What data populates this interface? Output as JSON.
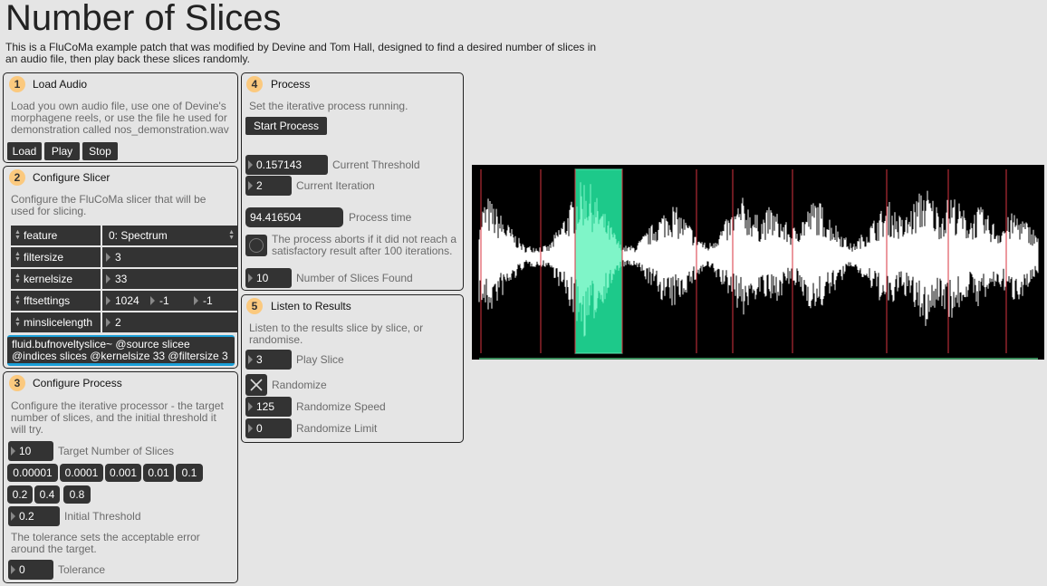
{
  "page": {
    "title": "Number of Slices",
    "description": "This is a FluCoMa example patch that was modified by Devine and Tom Hall, designed to find a desired number of slices in an audio file, then play back these slices randomly."
  },
  "colors": {
    "background": "#e5e5e5",
    "badge": "#fbc97e",
    "control": "#333333",
    "waveform_bg": "#000000",
    "waveform": "#ffffff",
    "selection": "#1dc98a",
    "slice_marker": "#d9333f"
  },
  "panel1": {
    "num": "1",
    "title": "Load Audio",
    "text": "Load you own audio file, use one of Devine's morphagene reels, or use the file he used for demonstration called nos_demonstration.wav",
    "buttons": [
      "Load",
      "Play",
      "Stop"
    ]
  },
  "panel2": {
    "num": "2",
    "title": "Configure Slicer",
    "text": "Configure the FluCoMa slicer that will be used for slicing.",
    "attrs": [
      {
        "name": "feature",
        "value": "0: Spectrum"
      },
      {
        "name": "filtersize",
        "value": "3"
      },
      {
        "name": "kernelsize",
        "value": "33"
      },
      {
        "name": "fftsettings",
        "value": "1024",
        "value2": "-1",
        "value3": "-1"
      },
      {
        "name": "minslicelength",
        "value": "2"
      }
    ],
    "object_text": "fluid.bufnoveltyslice~ @source slicee @indices slices @kernelsize 33 @filtersize 3"
  },
  "panel3": {
    "num": "3",
    "title": "Configure Process",
    "text": "Configure the iterative processor - the target number of slices, and the initial threshold it will try.",
    "target_value": "10",
    "target_label": "Target Number of Slices",
    "presets_row1": [
      "0.00001",
      "0.0001",
      "0.001",
      "0.01",
      "0.1"
    ],
    "presets_row2": [
      "0.2",
      "0.4",
      "0.8"
    ],
    "threshold_value": "0.2",
    "threshold_label": "Initial Threshold",
    "tolerance_text": "The tolerance sets the acceptable error around the target.",
    "tolerance_value": "0",
    "tolerance_label": "Tolerance"
  },
  "panel4": {
    "num": "4",
    "title": "Process",
    "text": "Set the iterative process running.",
    "start_button": "Start Process",
    "current_threshold_value": "0.157143",
    "current_threshold_label": "Current Threshold",
    "current_iteration_value": "2",
    "current_iteration_label": "Current Iteration",
    "process_time_value": "94.416504",
    "process_time_label": "Process time",
    "abort_text": "The process aborts if it did not reach a satisfactory result after 100 iterations.",
    "slices_found_value": "10",
    "slices_found_label": "Number of Slices Found"
  },
  "panel5": {
    "num": "5",
    "title": "Listen to Results",
    "text": "Listen to the results slice by slice, or randomise.",
    "play_slice_value": "3",
    "play_slice_label": "Play Slice",
    "randomize_label": "Randomize",
    "randomize_speed_value": "125",
    "randomize_speed_label": "Randomize Speed",
    "randomize_limit_value": "0",
    "randomize_limit_label": "Randomize Limit"
  },
  "waveform": {
    "slices": 10,
    "selected_slice": 3
  }
}
